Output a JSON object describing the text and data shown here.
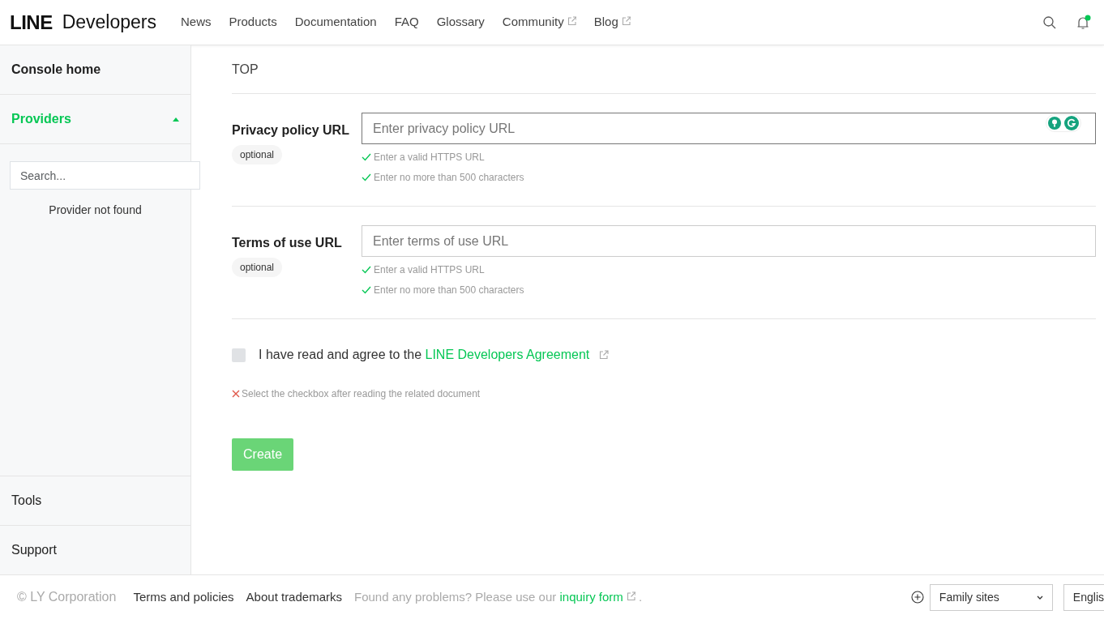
{
  "header": {
    "logo_bold": "LINE",
    "logo_light": "Developers",
    "nav": [
      {
        "label": "News",
        "external": false
      },
      {
        "label": "Products",
        "external": false
      },
      {
        "label": "Documentation",
        "external": false
      },
      {
        "label": "FAQ",
        "external": false
      },
      {
        "label": "Glossary",
        "external": false
      },
      {
        "label": "Community",
        "external": true
      },
      {
        "label": "Blog",
        "external": true
      }
    ],
    "notification_unread": true
  },
  "sidebar": {
    "console_home": "Console home",
    "providers": {
      "label": "Providers",
      "expanded": true,
      "search_placeholder": "Search...",
      "empty_message": "Provider not found"
    },
    "bottom_items": [
      "Tools",
      "Support"
    ]
  },
  "main": {
    "breadcrumb": "TOP",
    "fields": [
      {
        "label": "Privacy policy URL",
        "badge": "optional",
        "placeholder": "Enter privacy policy URL",
        "writing_assistant": true,
        "rules": [
          {
            "text": "Enter a valid HTTPS URL",
            "kind": "ok"
          },
          {
            "text": "Enter no more than 500 characters",
            "kind": "ok"
          }
        ]
      },
      {
        "label": "Terms of use URL",
        "badge": "optional",
        "placeholder": "Enter terms of use URL",
        "writing_assistant": false,
        "rules": [
          {
            "text": "Enter a valid HTTPS URL",
            "kind": "ok"
          },
          {
            "text": "Enter no more than 500 characters",
            "kind": "ok"
          }
        ]
      }
    ],
    "agreement": {
      "checked": false,
      "text": "I have read and agree to the",
      "link": "LINE Developers Agreement"
    },
    "agreement_error": {
      "text": "Select the checkbox after reading the related document",
      "kind": "error"
    },
    "submit": {
      "label": "Create",
      "disabled": true
    }
  },
  "footer": {
    "copyright": "© LY Corporation",
    "links": [
      "Terms and policies",
      "About trademarks"
    ],
    "notice": "Found any problems? Please use our",
    "notice_link": "inquiry form",
    "notice_end": ".",
    "family_sites": "Family sites",
    "language": "Englis"
  }
}
